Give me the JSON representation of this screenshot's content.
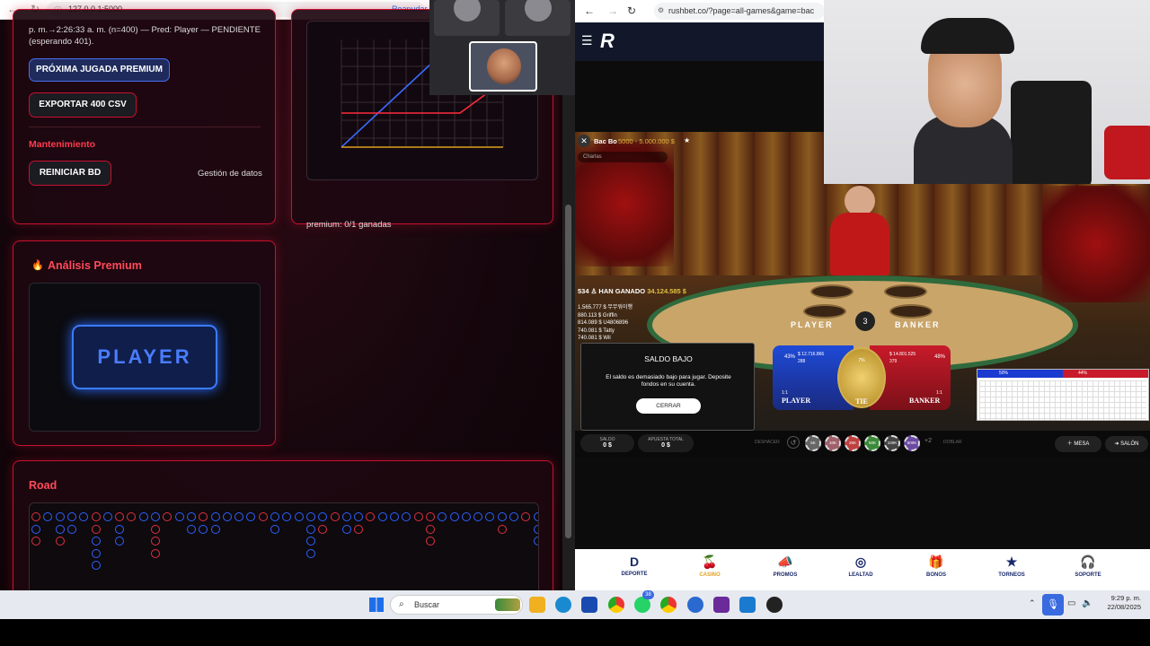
{
  "left_browser": {
    "url": "127.0.0.1:5000",
    "resume_label": "Reanudar",
    "status_line": "p. m.→2:26:33 a. m. (n=400) — Pred: Player — PENDIENTE (esperando 401).",
    "premium_button": "PRÓXIMA JUGADA PREMIUM",
    "export_button": "EXPORTAR 400 CSV",
    "maintenance_title": "Mantenimiento",
    "reset_button": "REINICIAR BD",
    "data_mgmt_label": "Gestión de datos",
    "premium_stats": "premium: 0/1 ganadas",
    "analysis_title": "Análisis Premium",
    "prediction": "PLAYER",
    "road_title": "Road"
  },
  "right_browser": {
    "url": "rushbet.co/?page=all-games&game=bac",
    "game_title": "Bac Bo",
    "game_limits": "5000 - 5.000.000 $",
    "chat_placeholder": "Charlas",
    "winners_count": "534",
    "winners_label": "HAN GANADO",
    "winners_amount": "34.124.585 $",
    "winners_list": [
      "1.565.777 $ 무무워이행",
      "880.113 $ Griffin",
      "814.089 $ U4806896",
      "740.081 $ Tatty",
      "740.081 $ Wil"
    ],
    "modal_title": "SALDO BAJO",
    "modal_text": "El saldo es demasiado bajo para jugar. Deposite fondos en su cuenta.",
    "modal_button": "CERRAR",
    "table_player": "PLAYER",
    "table_banker": "BANKER",
    "table_timer": "3",
    "bet_player_pct": "43%",
    "bet_player_amt": "$ 12.716.866",
    "bet_player_count": "288",
    "bet_tie_pct": "7%",
    "bet_banker_pct": "48%",
    "bet_banker_amt": "$ 14.801.525",
    "bet_banker_count": "379",
    "bet_player_label": "PLAYER",
    "bet_tie_label": "TIE",
    "bet_banker_label": "BANKER",
    "bet_player_odds": "1:1",
    "bet_banker_odds": "1:1",
    "road_pct": [
      "50%",
      "44%"
    ],
    "balance_label": "SALDO",
    "balance_value": "0 $",
    "total_bet_label": "APUESTA TOTAL",
    "total_bet_value": "0 $",
    "undo_label": "DESHACER",
    "double_label": "DOBLAR",
    "more_chips": "+2",
    "chips": [
      "5K",
      "10K",
      "25K",
      "50K",
      "100K",
      "500K"
    ],
    "mesa_button": "MESA",
    "salon_button": "SALÓN",
    "nav": [
      {
        "label": "DEPORTE",
        "icon": "D"
      },
      {
        "label": "CASINO",
        "icon": "🍒"
      },
      {
        "label": "PROMOS",
        "icon": "📣"
      },
      {
        "label": "LEALTAD",
        "icon": "◎"
      },
      {
        "label": "BONOS",
        "icon": "🎁"
      },
      {
        "label": "TORNEOS",
        "icon": "★"
      },
      {
        "label": "SOPORTE",
        "icon": "🎧"
      }
    ]
  },
  "taskbar": {
    "search_placeholder": "Buscar",
    "time": "9:29 p. m.",
    "date": "22/08/2025",
    "whatsapp_badge": "38"
  },
  "colors": {
    "accent_red": "#c8102e",
    "player_blue": "#2f6bff",
    "banker_red": "#e02030"
  }
}
